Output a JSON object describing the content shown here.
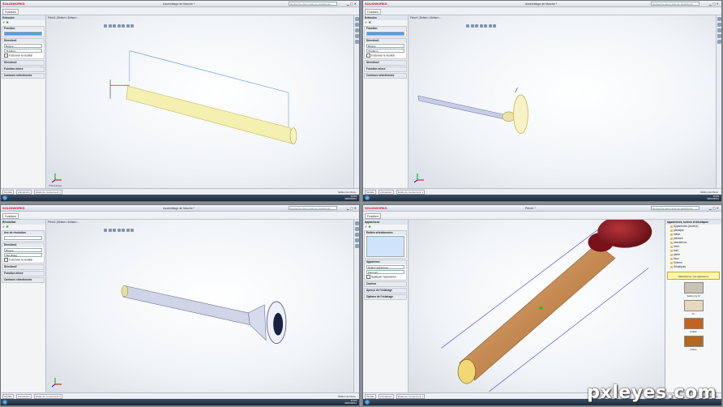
{
  "brand": {
    "name": "SOLIDWORKS",
    "color": "#c8102e"
  },
  "panels": [
    {
      "doc_title": "Assemblage de Marche *",
      "search_placeholder": "Recherche dans l'aide de SolidWorks",
      "command_tab": "Fonctions",
      "heads_up": "Pièce1 (Défaut<<Défaut>...",
      "view_label": "*Trimétrique",
      "pm_title": "Extrusion",
      "pm_section1": "Fonction",
      "pm_section2": "Direction1",
      "pm_field1": "Borgne",
      "pm_field2": "75.00mm",
      "pm_check": "Fusionner le résultat",
      "pm_section3": "Direction2",
      "pm_section4": "Fonction mince",
      "pm_section5": "Contours sélectionnés",
      "status_tabs": [
        "Modèle",
        "Animation1",
        "Etude de mouvement 1"
      ],
      "status_right": "Édition de Pièce"
    },
    {
      "doc_title": "Assemblage de Marche *",
      "search_placeholder": "Recherche dans l'aide de SolidWorks",
      "command_tab": "Fonctions",
      "heads_up": "Pièce1 (Défaut<<Défaut>...",
      "view_label": "",
      "pm_title": "Extrusion",
      "pm_section1": "Fonction",
      "pm_section2": "Direction1",
      "pm_field1": "Borgne",
      "pm_field2": "75.00mm",
      "pm_check": "Fusionner le résultat",
      "pm_section3": "Direction2",
      "pm_section4": "Fonction mince",
      "pm_section5": "Contours sélectionnés",
      "status_tabs": [
        "Modèle",
        "Animation1",
        "Etude de mouvement 1"
      ],
      "status_right": "Édition de Pièce"
    },
    {
      "doc_title": "Assemblage de Marche *",
      "search_placeholder": "Recherche dans l'aide de SolidWorks",
      "command_tab": "Fonctions",
      "heads_up": "Pièce1 (Défaut<<Défaut>...",
      "view_label": "",
      "pm_title": "Révolution",
      "pm_section1": "Axe de révolution",
      "pm_section2": "Direction1",
      "pm_field1": "Borgne",
      "pm_field2": "360.00deg",
      "pm_check": "Fusionner le résultat",
      "pm_section3": "Direction2",
      "pm_section4": "Fonction mince",
      "pm_section5": "Contours sélectionnés",
      "status_tabs": [
        "Modèle",
        "Animation1",
        "Etude de mouvement 1"
      ],
      "status_right": "Édition de Pièce"
    },
    {
      "doc_title": "Pièce1 *",
      "search_placeholder": "Recherche dans l'aide de SolidWorks",
      "command_tab": "Fonctions",
      "heads_up": "Pièce1 (Défaut<<Défaut>...",
      "view_label": "",
      "pm_title": "Apparences",
      "pm_section1": "Entités sélectionnées",
      "pm_section2": "Apparence",
      "pm_field1": "Défaut l'apparence",
      "pm_field2": "Parcourir...",
      "pm_check": "Appliquer l'apparence",
      "pm_section3": "Couleur",
      "pm_section4": "Aperçu de l'éclairage",
      "pm_section5": "Options de l'éclairage",
      "status_tabs": [
        "Modèle",
        "Animation1",
        "Etude de mouvement 1"
      ],
      "status_right": "Édition de Pièce"
    }
  ],
  "library": {
    "title": "Apparences, scènes et décalques",
    "tree": [
      "Apparences (couleur)",
      "plastique",
      "métal",
      "peinture",
      "caoutchouc",
      "verre",
      "bois",
      "pierre",
      "tissu",
      "Scènes",
      "Décalques"
    ],
    "selected_note": "Sélectionner une apparence",
    "swatches": [
      {
        "label": "Satiny ply III",
        "color": "#c9c3b3"
      },
      {
        "label": "lin",
        "color": "#e5d9bf"
      },
      {
        "label": "érable",
        "color": "#c0641f"
      },
      {
        "label": "chêne",
        "color": "#b4681c"
      }
    ]
  },
  "taskbar": {
    "time": "11:03",
    "date": "30/03/2011"
  },
  "watermark": "pxleyes.com"
}
